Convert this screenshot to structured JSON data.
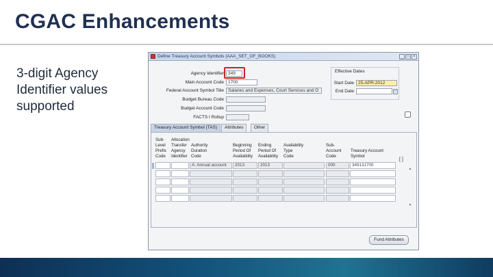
{
  "slide": {
    "title": "CGAC Enhancements",
    "bullet": "3-digit Agency Identifier values supported"
  },
  "window": {
    "title": "Define Treasury Account Symbols (AAA_SET_OF_BOOKS)",
    "buttons": [
      "_",
      "□",
      "×"
    ]
  },
  "form": {
    "agency_identifier": {
      "label": "Agency Identifier",
      "value": "349"
    },
    "main_account_code": {
      "label": "Main Account Code",
      "value": "1700"
    },
    "federal_account_symbol_title": {
      "label": "Federal Account Symbol Title",
      "value": "Salaries and Expenses, Court Services and O"
    },
    "budget_bureau_code": {
      "label": "Budget Bureau Code",
      "value": ""
    },
    "budget_account_code": {
      "label": "Budget Account Code",
      "value": ""
    },
    "facts_i_rollup": {
      "label": "FACTS I Rollup",
      "value": ""
    }
  },
  "effective_dates": {
    "title": "Effective Dates",
    "start_label": "Start Date",
    "start_value": "25-APR-2012",
    "end_label": "End Date",
    "end_value": ""
  },
  "tabs": [
    {
      "label": "Treasury Account Symbol (TAS)",
      "active": true
    },
    {
      "label": "Attributes",
      "active": false
    },
    {
      "label": "Other",
      "active": false
    }
  ],
  "table": {
    "headers": {
      "sub_level_prefix": "Sub-\nLevel\nPrefix\nCode",
      "allocation_transfer": "Allocation\nTransfer\nAgency\nIdentifier",
      "authority_duration": "Authority\nDuration\nCode",
      "beginning_period": "Beginning\nPeriod Of\nAvailability",
      "ending_period": "Ending\nPeriod Of\nAvailability",
      "availability_type": "Availability\nType\nCode",
      "sub_account": "Sub-\nAccount\nCode",
      "tas": "Treasury Account\nSymbol"
    },
    "row1": {
      "authority_duration": "A: Annual account",
      "beginning_period": "2013",
      "ending_period": "2013",
      "sub_account": "000",
      "tas": "349131700"
    },
    "bracket": "[ ]"
  },
  "fund_attributes_button": "Fund Attributes"
}
